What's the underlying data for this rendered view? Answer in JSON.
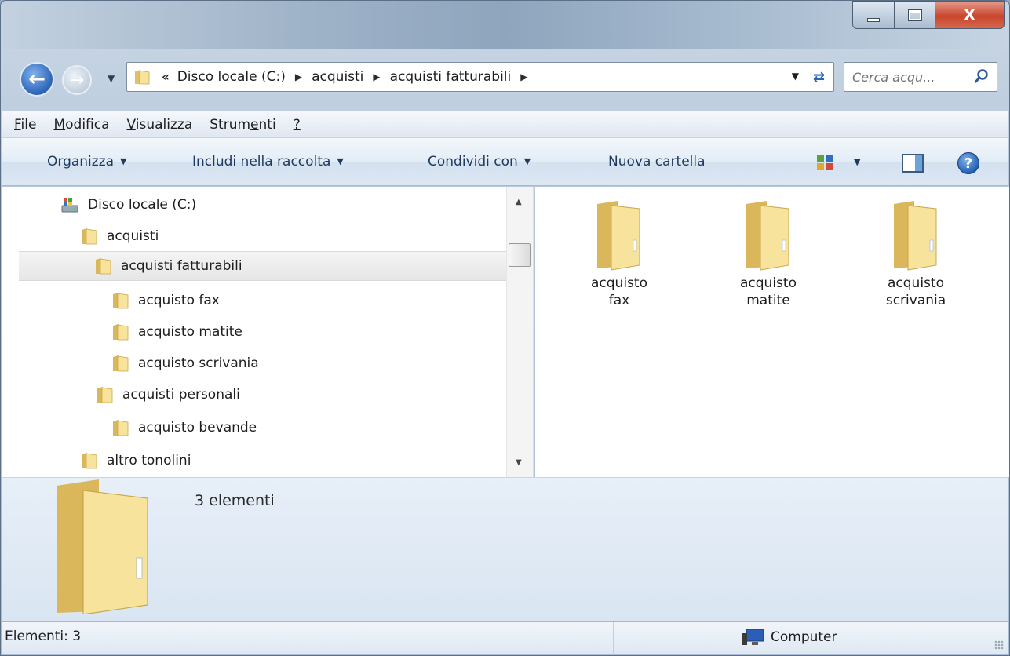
{
  "window": {
    "caption": {
      "close_label": "X"
    }
  },
  "nav": {
    "breadcrumbs": [
      {
        "label": "Disco locale (C:)"
      },
      {
        "label": "acquisti"
      },
      {
        "label": "acquisti fatturabili"
      }
    ],
    "overflow_label": "«",
    "search_placeholder": "Cerca acqu..."
  },
  "menubar": {
    "items": [
      {
        "label": "File",
        "underline": "F",
        "rest": "ile"
      },
      {
        "label": "Modifica",
        "underline": "M",
        "rest": "odifica"
      },
      {
        "label": "Visualizza",
        "underline": "V",
        "rest": "isualizza"
      },
      {
        "label": "Strumenti",
        "pre": "Strum",
        "underline": "e",
        "rest": "nti"
      },
      {
        "label": "?",
        "underline": "?",
        "rest": ""
      }
    ]
  },
  "commandbar": {
    "organize": "Organizza",
    "include": "Includi nella raccolta",
    "share": "Condividi con",
    "new_folder": "Nuova cartella",
    "help": "?"
  },
  "navtree": {
    "items": [
      {
        "label": "Disco locale (C:)",
        "icon": "drive-icon",
        "level": 0
      },
      {
        "label": "acquisti",
        "icon": "folder-icon",
        "level": 1
      },
      {
        "label": "acquisti fatturabili",
        "icon": "folder-icon",
        "level": 2,
        "selected": true
      },
      {
        "label": "acquisto fax",
        "icon": "folder-icon",
        "level": 3
      },
      {
        "label": "acquisto matite",
        "icon": "folder-icon",
        "level": 3
      },
      {
        "label": "acquisto scrivania",
        "icon": "folder-icon",
        "level": 3
      },
      {
        "label": "acquisti personali",
        "icon": "folder-icon",
        "level": 2
      },
      {
        "label": "acquisto bevande",
        "icon": "folder-icon",
        "level": 3
      },
      {
        "label": "altro tonolini",
        "icon": "folder-icon",
        "level": 1
      }
    ]
  },
  "content": {
    "items": [
      {
        "line1": "acquisto",
        "line2": "fax"
      },
      {
        "line1": "acquisto",
        "line2": "matite"
      },
      {
        "line1": "acquisto",
        "line2": "scrivania"
      }
    ]
  },
  "details": {
    "count_text": "3 elementi"
  },
  "status": {
    "count_text": "Elementi: 3",
    "zone_text": "Computer"
  },
  "colors": {
    "folder_light": "#f7e39c",
    "folder_dark": "#d9b75a",
    "accent_blue": "#2c64b7"
  }
}
